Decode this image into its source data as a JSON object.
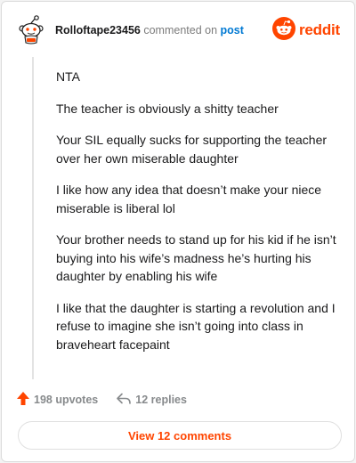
{
  "header": {
    "username": "Rolloftape23456",
    "commented_text": "commented on",
    "post_link": "post",
    "brand_word": "reddit",
    "avatar_icon": "reddit-snoo-avatar-icon",
    "brand_icon": "reddit-logo-icon"
  },
  "comment": {
    "paragraphs": [
      "NTA",
      "The teacher is obviously a shitty teacher",
      "Your SIL equally sucks for supporting the teacher over her own miserable daughter",
      "I like how any idea that doesn’t make your niece miserable is liberal lol",
      "Your brother needs to stand up for his kid if he isn’t buying into his wife’s madness he’s hurting his daughter by enabling his wife",
      "I like that the daughter is starting a revolution and I refuse to imagine she isn’t going into class in braveheart facepaint"
    ]
  },
  "actions": {
    "upvotes": "198 upvotes",
    "replies": "12 replies",
    "upvote_icon": "upvote-arrow-icon",
    "reply_icon": "reply-arrow-icon"
  },
  "footer": {
    "view_comments": "View 12 comments"
  },
  "colors": {
    "brand": "#ff4500",
    "link": "#0079d3",
    "muted": "#878a8c"
  }
}
